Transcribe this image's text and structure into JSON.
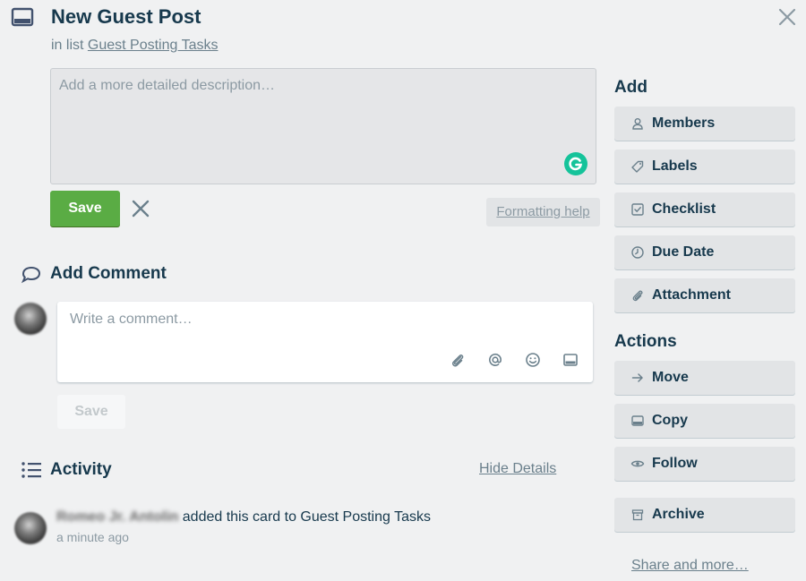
{
  "card": {
    "title": "New Guest Post",
    "in_list_prefix": "in list",
    "list_name": "Guest Posting Tasks"
  },
  "description": {
    "placeholder": "Add a more detailed description…",
    "save_label": "Save",
    "formatting_help": "Formatting help"
  },
  "comment": {
    "title": "Add Comment",
    "placeholder": "Write a comment…",
    "save_label": "Save",
    "tools": [
      "attachment-icon",
      "mention-icon",
      "emoji-icon",
      "card-icon"
    ]
  },
  "activity": {
    "title": "Activity",
    "hide_details": "Hide Details",
    "entries": [
      {
        "user": "Romeo Jr. Antolin",
        "action": "added this card to Guest Posting Tasks",
        "time": "a minute ago"
      }
    ]
  },
  "sidebar": {
    "add_title": "Add",
    "add_items": [
      {
        "label": "Members",
        "icon": "person-icon"
      },
      {
        "label": "Labels",
        "icon": "tag-icon"
      },
      {
        "label": "Checklist",
        "icon": "checkbox-icon"
      },
      {
        "label": "Due Date",
        "icon": "clock-icon"
      },
      {
        "label": "Attachment",
        "icon": "paperclip-icon"
      }
    ],
    "actions_title": "Actions",
    "action_items": [
      {
        "label": "Move",
        "icon": "arrow-right-icon"
      },
      {
        "label": "Copy",
        "icon": "copy-card-icon"
      },
      {
        "label": "Follow",
        "icon": "eye-icon"
      },
      {
        "label": "Archive",
        "icon": "archive-icon"
      }
    ],
    "share_more": "Share and more…"
  },
  "colors": {
    "save_green": "#5aac44",
    "grammarly_green": "#15c39a",
    "text_dark": "#17394d",
    "text_muted": "#6b808c"
  }
}
